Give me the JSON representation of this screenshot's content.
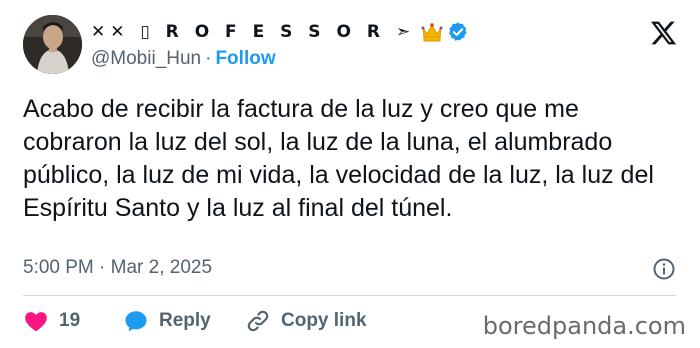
{
  "author": {
    "display_name": "✕✕ ▯ R O F E S S O R ➣",
    "handle": "@Mobii_Hun",
    "separator": "·",
    "follow_label": "Follow",
    "verified": true
  },
  "tweet": {
    "text": "Acabo de recibir la factura de la luz y creo que me cobraron la luz del sol, la luz de la luna, el alumbrado público, la luz de mi vida, la velocidad de la luz, la luz del Espíritu Santo y la luz al final del túnel.",
    "timestamp": "5:00 PM · Mar 2, 2025"
  },
  "actions": {
    "like_count": "19",
    "reply_label": "Reply",
    "copy_link_label": "Copy link"
  },
  "watermark": "boredpanda.com",
  "colors": {
    "accent": "#1d9bf0",
    "like": "#f91880",
    "text": "#0f1419",
    "muted": "#536471"
  }
}
